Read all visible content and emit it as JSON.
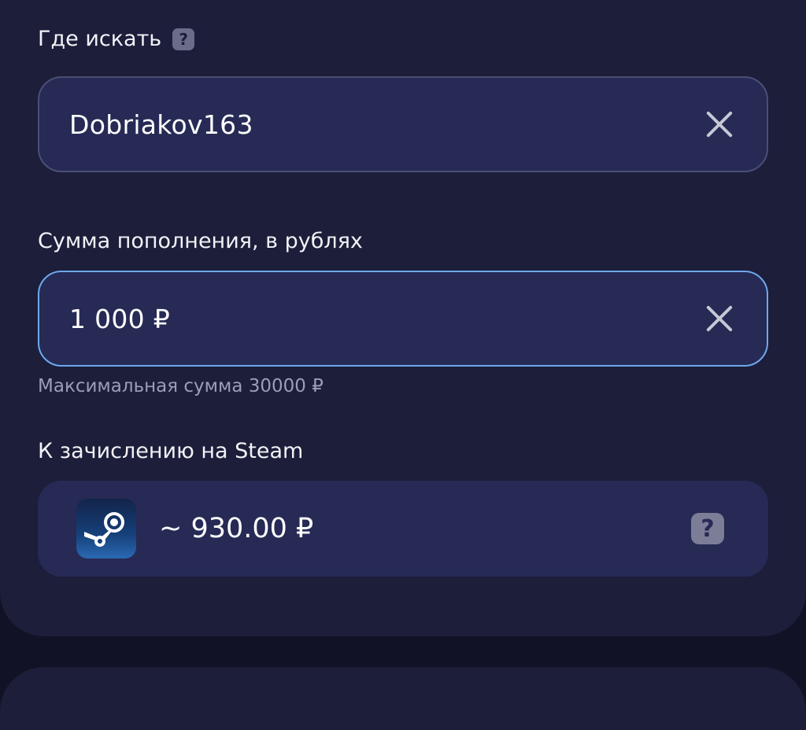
{
  "search": {
    "label": "Где искать",
    "help_icon": "question-icon",
    "value": "Dobriakov163",
    "clear_icon": "close-icon"
  },
  "amount": {
    "label": "Сумма пополнения, в рублях",
    "value": "1 000 ₽",
    "clear_icon": "close-icon",
    "hint": "Максимальная сумма 30000 ₽"
  },
  "credit": {
    "label": "К зачислению на Steam",
    "logo_icon": "steam-logo-icon",
    "value": "~ 930.00 ₽",
    "help_icon": "question-icon"
  },
  "colors": {
    "background": "#121226",
    "card": "#1c1e3a",
    "field": "#262a55",
    "focus_border": "#6ea8ec"
  }
}
